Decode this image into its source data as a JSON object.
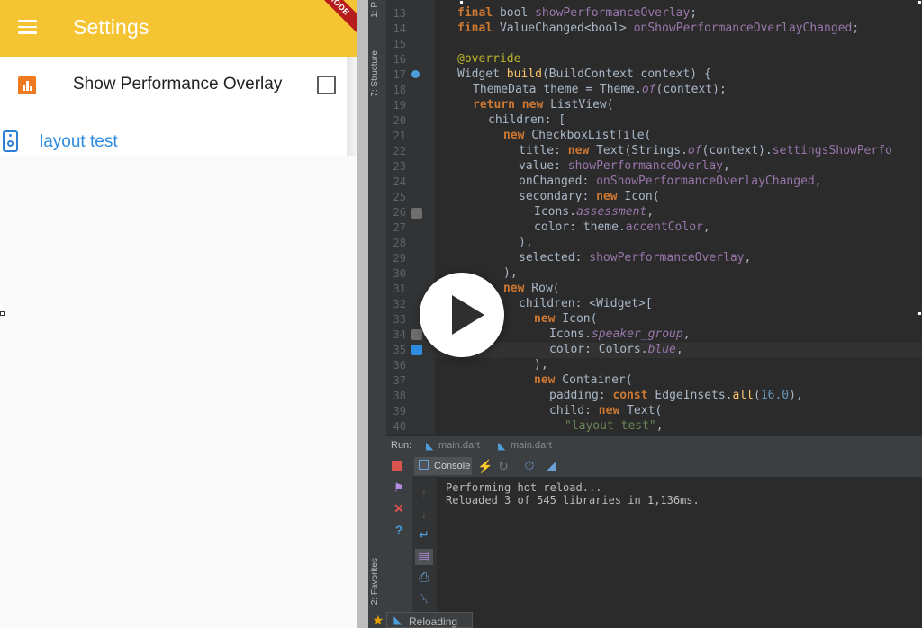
{
  "app": {
    "title": "Settings",
    "debug_banner": "MODE",
    "tile_title": "Show Performance Overlay",
    "checkbox_checked": false,
    "layout_text": "layout test",
    "accent_color": "#f5c433",
    "icon_orange": "#ef7a1f",
    "link_blue": "#2e8be0"
  },
  "ide": {
    "side_tabs": [
      "1: P",
      "7: Structure",
      "2: Favorites"
    ],
    "line_numbers": [
      "13",
      "14",
      "15",
      "16",
      "17",
      "18",
      "19",
      "20",
      "21",
      "22",
      "23",
      "24",
      "25",
      "26",
      "27",
      "28",
      "29",
      "30",
      "31",
      "32",
      "33",
      "34",
      "35",
      "36",
      "37",
      "38",
      "39",
      "40"
    ],
    "run_label": "Run:",
    "run_tabs": [
      "main.dart",
      "main.dart"
    ],
    "console_tab": "Console",
    "console_lines": [
      "Performing hot reload...",
      "Reloaded 3 of 545 libraries in 1,136ms."
    ],
    "status": "Reloading"
  }
}
